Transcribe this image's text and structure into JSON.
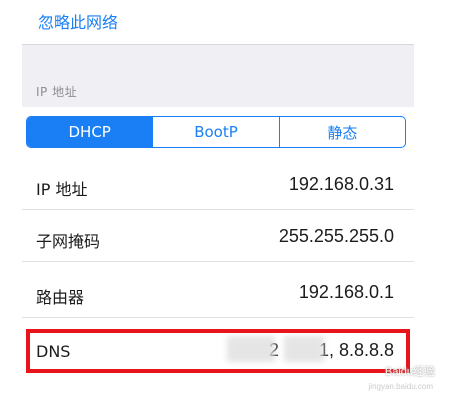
{
  "forget_network": {
    "label": "忽略此网络"
  },
  "ip_section": {
    "header": "IP 地址"
  },
  "segmented": {
    "options": [
      {
        "label": "DHCP",
        "selected": true
      },
      {
        "label": "BootP",
        "selected": false
      },
      {
        "label": "静态",
        "selected": false
      }
    ]
  },
  "rows": [
    {
      "label": "IP 地址",
      "value": "192.168.0.31"
    },
    {
      "label": "子网掩码",
      "value": "255.255.255.0"
    },
    {
      "label": "路由器",
      "value": "192.168.0.1"
    },
    {
      "label": "DNS",
      "value": "2        1, 8.8.8.8"
    }
  ],
  "watermark": {
    "text": "Baidu经验",
    "sub": "jingyan.baidu.com"
  },
  "colors": {
    "accent": "#1a7ff5",
    "highlight": "#e8141b",
    "band": "#efeff4"
  }
}
